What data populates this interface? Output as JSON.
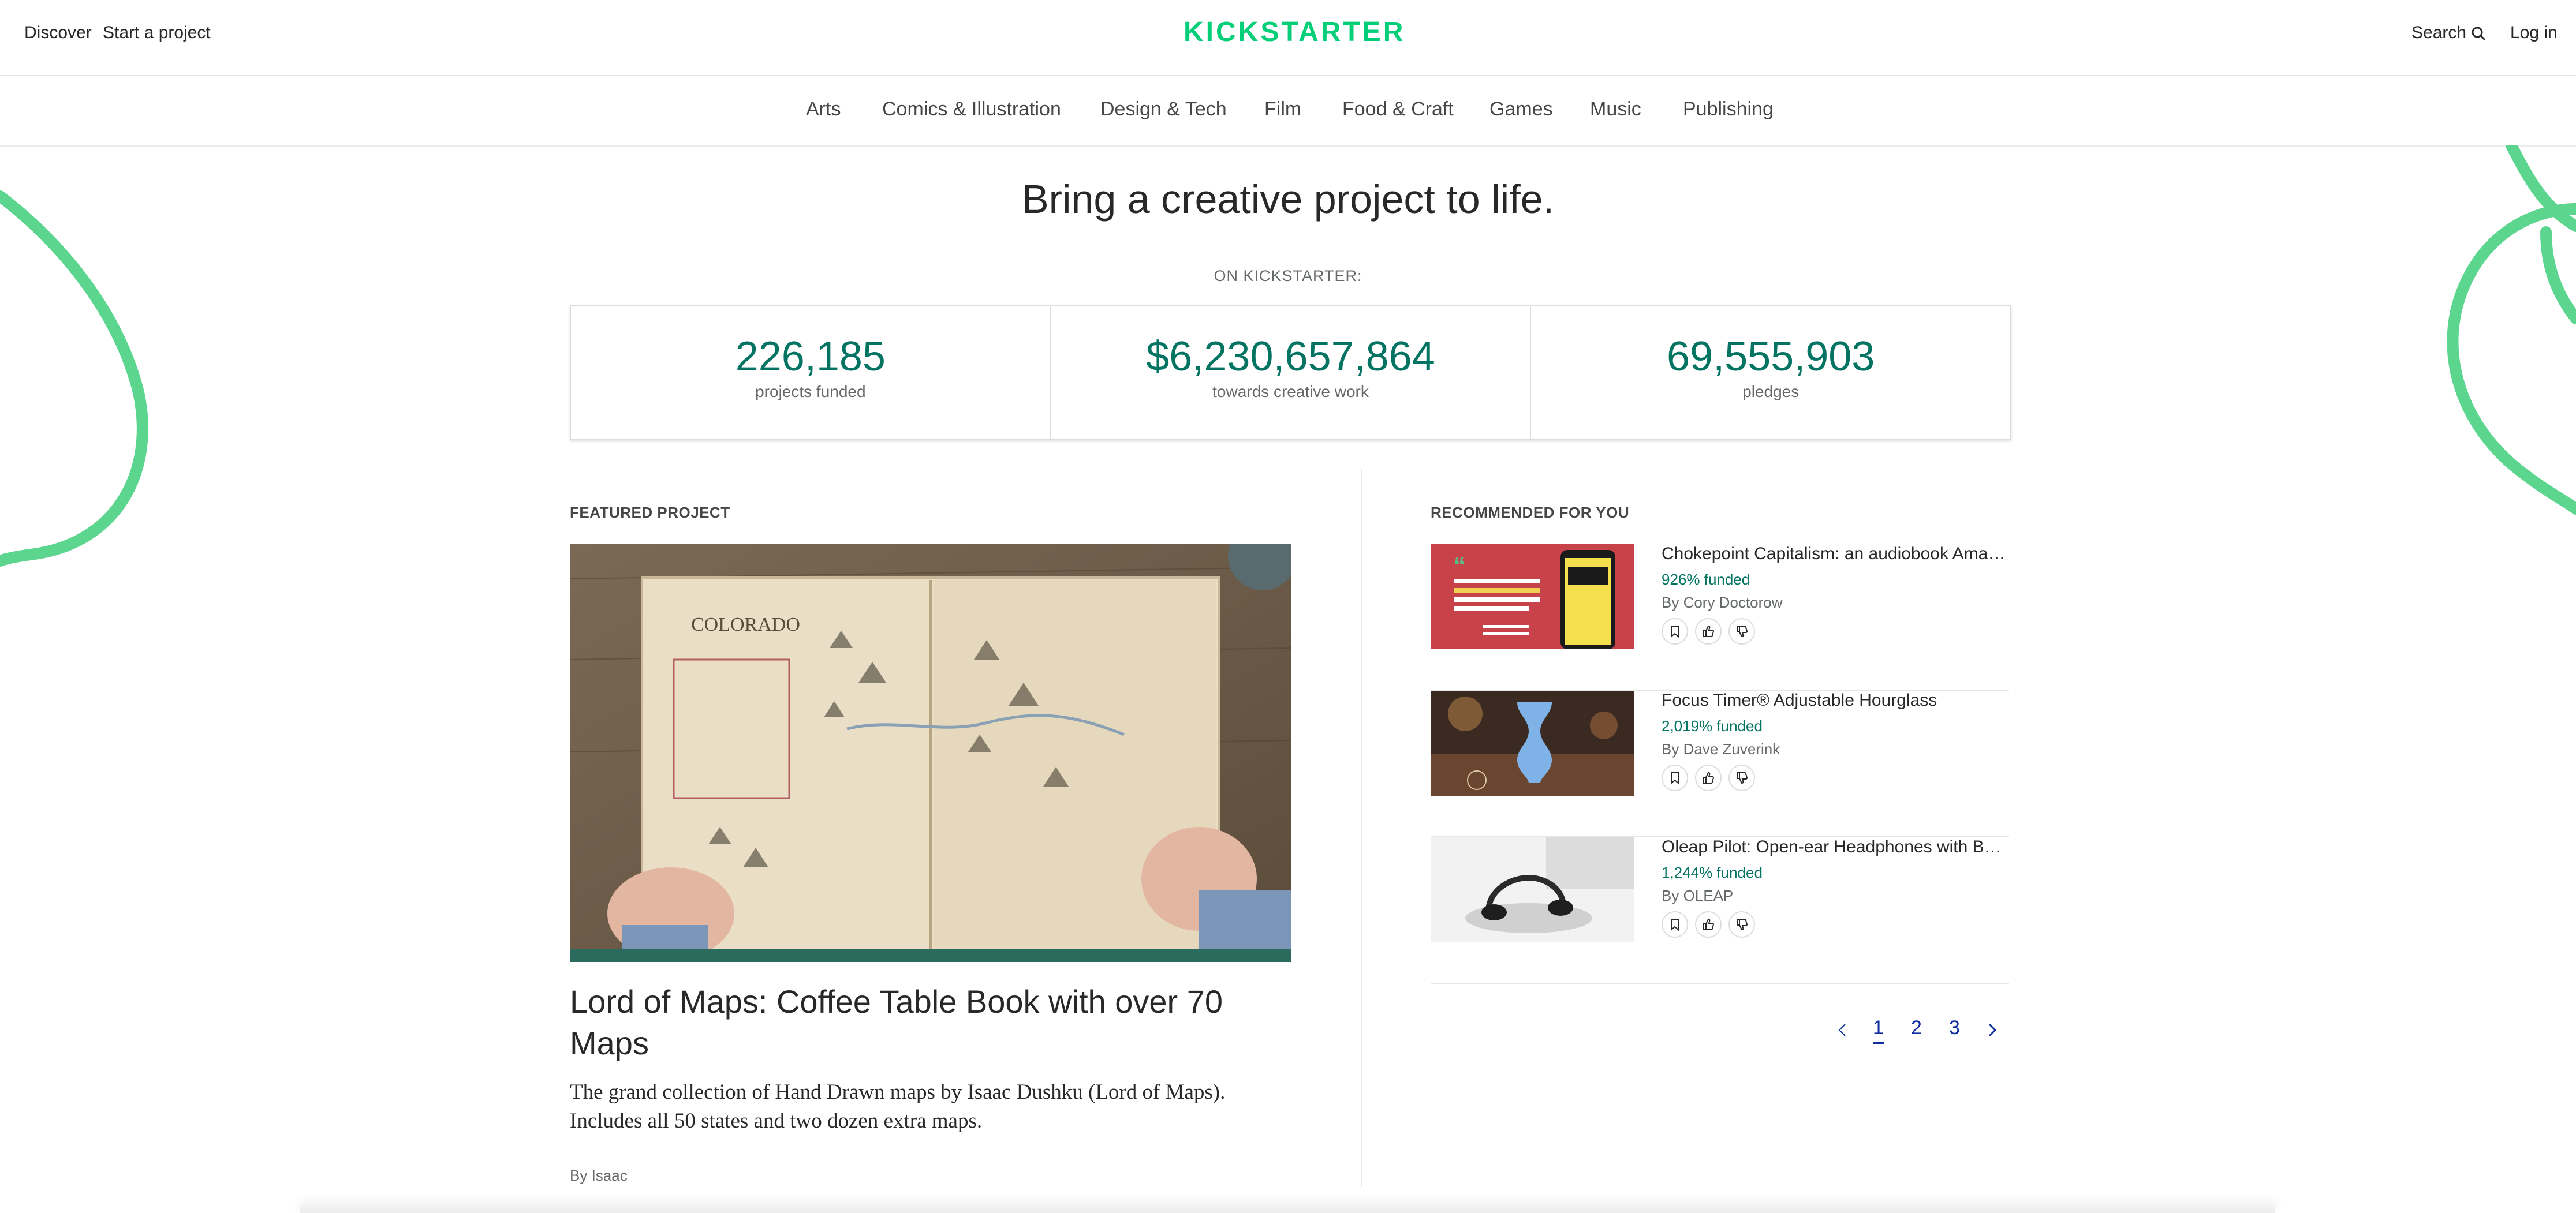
{
  "header": {
    "discover_label": "Discover",
    "start_label": "Start a project",
    "logo_text": "KICKSTARTER",
    "search_label": "Search",
    "login_label": "Log in"
  },
  "categories": [
    "Arts",
    "Comics & Illustration",
    "Design & Tech",
    "Film",
    "Food & Craft",
    "Games",
    "Music",
    "Publishing"
  ],
  "hero": {
    "title": "Bring a creative project to life.",
    "stats_label": "ON KICKSTARTER:"
  },
  "stats": [
    {
      "value": "226,185",
      "label": "projects funded"
    },
    {
      "value": "$6,230,657,864",
      "label": "towards creative work"
    },
    {
      "value": "69,555,903",
      "label": "pledges"
    }
  ],
  "featured": {
    "section_label": "FEATURED PROJECT",
    "title": "Lord of Maps: Coffee Table Book with over 70 Maps",
    "blurb": "The grand collection of Hand Drawn maps by Isaac Dushku (Lord of Maps). Includes all 50 states and two dozen extra maps.",
    "by": "By Isaac"
  },
  "recommended": {
    "section_label": "RECOMMENDED FOR YOU",
    "items": [
      {
        "title": "Chokepoint Capitalism: an audiobook Amazo...",
        "funded": "926% funded",
        "by": "By Cory Doctorow"
      },
      {
        "title": "Focus Timer® Adjustable Hourglass",
        "funded": "2,019% funded",
        "by": "By Dave Zuverink"
      },
      {
        "title": "Oleap Pilot: Open-ear Headphones with Best...",
        "funded": "1,244% funded",
        "by": "By OLEAP"
      }
    ]
  },
  "pagination": {
    "pages": [
      "1",
      "2",
      "3"
    ],
    "current": "1"
  },
  "colors": {
    "brand": "#05ce78",
    "accent_text": "#037362",
    "link": "#0f2e9f"
  }
}
